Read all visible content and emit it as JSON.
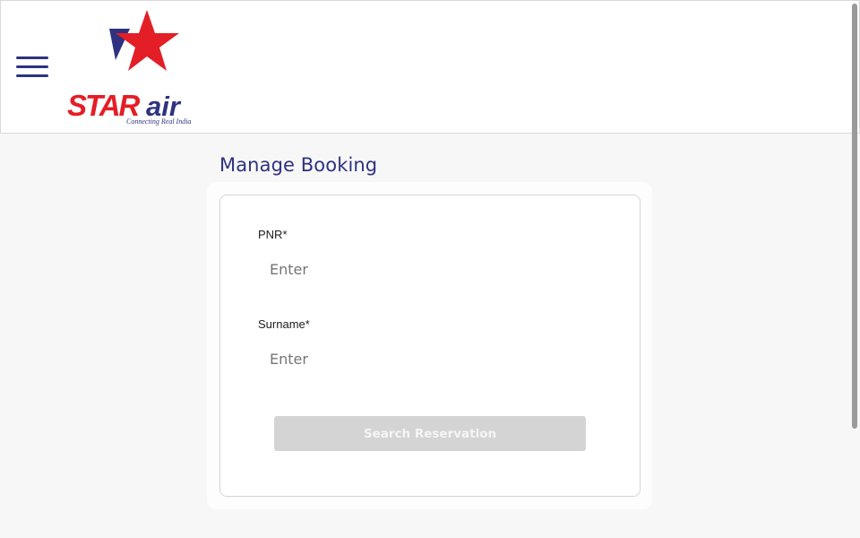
{
  "header": {
    "menu_icon": "hamburger-menu-icon",
    "logo": {
      "brand_text_star": "STAR",
      "brand_text_air": "air",
      "tagline": "Connecting Real India",
      "colors": {
        "red": "#e41e26",
        "navy": "#2e3280"
      }
    }
  },
  "main": {
    "title": "Manage Booking",
    "form": {
      "pnr": {
        "label": "PNR*",
        "placeholder": "Enter",
        "value": ""
      },
      "surname": {
        "label": "Surname*",
        "placeholder": "Enter",
        "value": ""
      },
      "submit_label": "Search Reservation",
      "submit_disabled": true
    }
  },
  "colors": {
    "accent": "#2e3280",
    "page_background": "#f7f7f7",
    "button_disabled": "#d4d4d4"
  }
}
